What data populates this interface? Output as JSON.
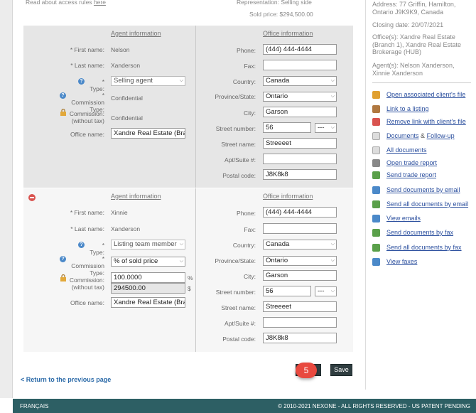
{
  "top": {
    "access_rules_prefix": "Read about access rules",
    "access_rules_link": "here",
    "representation": "Representation: Selling side",
    "sold_price": "Sold price: $294,500.00"
  },
  "agent_blocks": [
    {
      "agent_title": "Agent information",
      "office_title": "Office information",
      "first_name_label": "* First name:",
      "first_name": "Nelson",
      "last_name_label": "* Last name:",
      "last_name": "Xanderson",
      "type_label": "* Type:",
      "type_value": "Selling agent",
      "commission_type_label": "* Commission Type:",
      "commission_type": "Confidential",
      "commission_label": "Commission: (without tax)",
      "commission": "Confidential",
      "office_name_label": "Office name:",
      "office_name": "Xandre Real Estate (Bra",
      "phone_label": "Phone:",
      "phone": "(444) 444-4444",
      "fax_label": "Fax:",
      "fax": "",
      "country_label": "Country:",
      "country": "Canada",
      "province_label": "Province/State:",
      "province": "Ontario",
      "city_label": "City:",
      "city": "Garson",
      "street_number_label": "Street number:",
      "street_number": "56",
      "street_suffix": "---",
      "street_name_label": "Street name:",
      "street_name": "Streeeet",
      "apt_label": "Apt/Suite #:",
      "apt": "",
      "postal_label": "Postal code:",
      "postal": "J8K8k8"
    },
    {
      "agent_title": "Agent information",
      "office_title": "Office information",
      "first_name_label": "* First name:",
      "first_name": "Xinnie",
      "last_name_label": "* Last name:",
      "last_name": "Xanderson",
      "type_label": "* Type:",
      "type_value": "Listing team member",
      "commission_type_label": "* Commission Type:",
      "commission_type": "% of sold price",
      "commission_label": "Commission: (without tax)",
      "commission_pct": "100.0000",
      "commission_pct_unit": "%",
      "commission_amount": "294500.00",
      "commission_amount_unit": "$",
      "office_name_label": "Office name:",
      "office_name": "Xandre Real Estate (Bra",
      "phone_label": "Phone:",
      "phone": "(444) 444-4444",
      "fax_label": "Fax:",
      "fax": "",
      "country_label": "Country:",
      "country": "Canada",
      "province_label": "Province/State:",
      "province": "Ontario",
      "city_label": "City:",
      "city": "Garson",
      "street_number_label": "Street number:",
      "street_number": "56",
      "street_suffix": "---",
      "street_name_label": "Street name:",
      "street_name": "Streeeet",
      "apt_label": "Apt/Suite #:",
      "apt": "",
      "postal_label": "Postal code:",
      "postal": "J8K8k8"
    }
  ],
  "sidebar": {
    "address": "Address: 77 Griffin, Hamilton, Ontario J9K9K9, Canada",
    "closing_date": "Closing date: 20/07/2021",
    "offices": "Office(s): Xandre Real Estate (Branch 1), Xandre Real Estate Brokerage (HUB)",
    "agents": "Agent(s): Nelson Xanderson, Xinnie Xanderson",
    "links": [
      {
        "label": "Open associated client's file",
        "icon": "folder-open-icon",
        "color": "#e0a030"
      },
      {
        "label": "Link to a listing",
        "icon": "house-link-icon",
        "color": "#b07840"
      },
      {
        "label": "Remove link with client's file",
        "icon": "folder-remove-icon",
        "color": "#d9534f"
      },
      {
        "label": "Documents",
        "label_sep": "&",
        "label2": "Follow-up",
        "icon": "document-icon",
        "color": "#dddddd"
      },
      {
        "label": "All documents",
        "icon": "documents-icon",
        "color": "#dddddd"
      },
      {
        "label": "Open trade report",
        "icon": "report-icon",
        "color": "#888888"
      },
      {
        "label": "Send trade report",
        "icon": "send-report-icon",
        "color": "#5aa04a"
      },
      {
        "label": "Send documents by email",
        "icon": "email-document-icon",
        "color": "#4b89c9"
      },
      {
        "label": "Send all documents by email",
        "icon": "email-all-icon",
        "color": "#5aa04a"
      },
      {
        "label": "View emails",
        "icon": "envelope-icon",
        "color": "#4b89c9"
      },
      {
        "label": "Send documents by fax",
        "icon": "fax-icon",
        "color": "#5aa04a"
      },
      {
        "label": "Send all documents by fax",
        "icon": "fax-all-icon",
        "color": "#5aa04a"
      },
      {
        "label": "View faxes",
        "icon": "view-fax-icon",
        "color": "#4b89c9"
      }
    ]
  },
  "actions": {
    "return_label": "< Return to the previous page",
    "save_label": "Save",
    "step_badge": "5"
  },
  "footer": {
    "language": "FRANÇAIS",
    "copyright": "© 2010-2021 NEXONE - ALL RIGHTS RESERVED - US PATENT PENDING"
  },
  "colors": {
    "footer_bg": "#2d5f64",
    "link": "#2b4f9e",
    "badge": "#e8493f",
    "button": "#2f3d40"
  }
}
